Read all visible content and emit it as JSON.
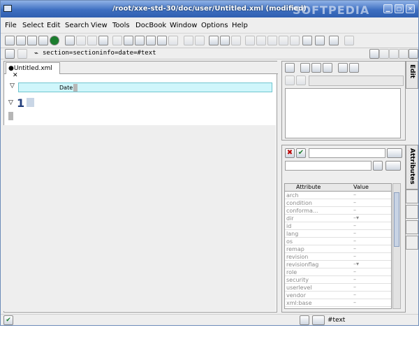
{
  "window": {
    "title": "/root/xxe-std-30/doc/user/Untitled.xml (modified)",
    "watermark": "SOFTPEDIA"
  },
  "menu": [
    "File",
    "Select",
    "Edit",
    "Search",
    "View",
    "Tools",
    "DocBook",
    "Window",
    "Options",
    "Help"
  ],
  "node_path": "section=sectioninfo=date=#text",
  "editor": {
    "tab_label": "●Untitled.xml",
    "tab_close": "✕",
    "date_label": "Date",
    "heading_number": "1"
  },
  "side_tabs": {
    "edit": "Edit",
    "attributes": "Attributes"
  },
  "attributes": {
    "header": [
      "Attribute",
      "Value"
    ],
    "rows": [
      {
        "name": "arch",
        "value": "–"
      },
      {
        "name": "condition",
        "value": "–"
      },
      {
        "name": "conforma...",
        "value": "–"
      },
      {
        "name": "dir",
        "value": "–▾"
      },
      {
        "name": "id",
        "value": "–"
      },
      {
        "name": "lang",
        "value": "–"
      },
      {
        "name": "os",
        "value": "–"
      },
      {
        "name": "remap",
        "value": "–"
      },
      {
        "name": "revision",
        "value": "–"
      },
      {
        "name": "revisionflag",
        "value": "–▾"
      },
      {
        "name": "role",
        "value": "–"
      },
      {
        "name": "security",
        "value": "–"
      },
      {
        "name": "userlevel",
        "value": "–"
      },
      {
        "name": "vendor",
        "value": "–"
      },
      {
        "name": "xml:base",
        "value": "–"
      }
    ]
  },
  "status": {
    "text": "#text"
  },
  "colors": {
    "title_bar": "#3e6fc1",
    "date_box": "#cff6fb"
  }
}
